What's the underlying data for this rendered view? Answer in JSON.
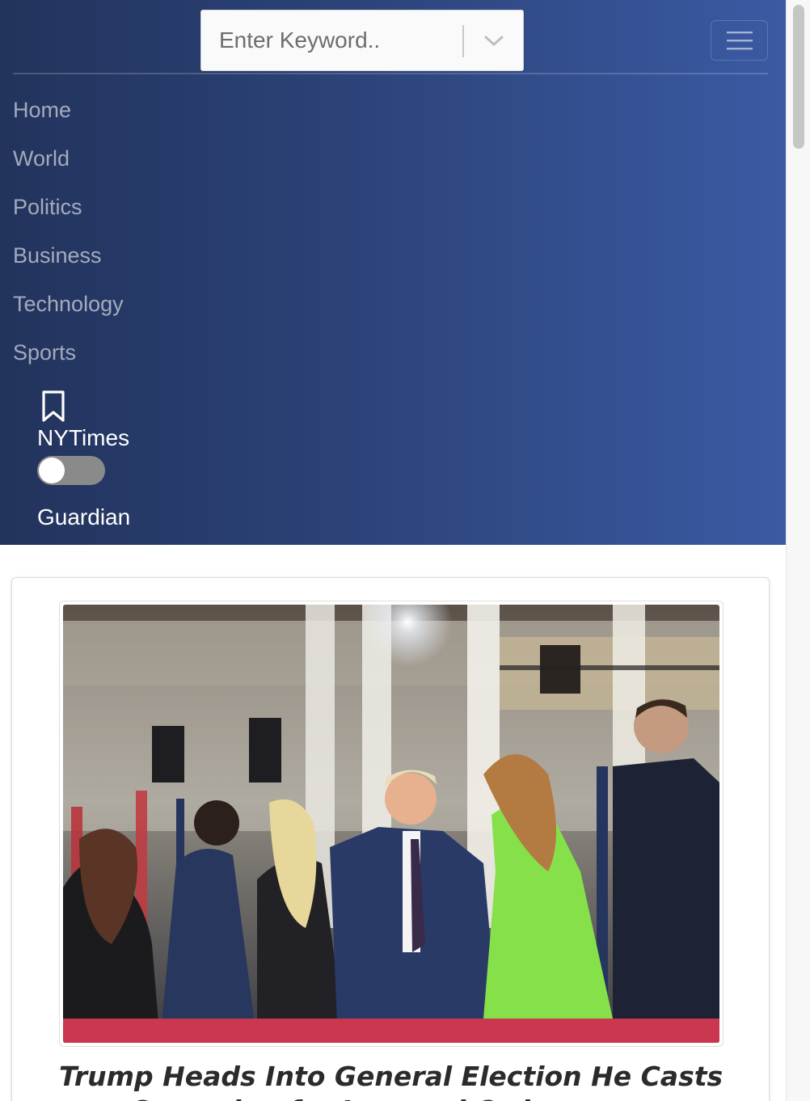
{
  "search": {
    "placeholder": "Enter Keyword.."
  },
  "nav": {
    "items": [
      {
        "label": "Home"
      },
      {
        "label": "World"
      },
      {
        "label": "Politics"
      },
      {
        "label": "Business"
      },
      {
        "label": "Technology"
      },
      {
        "label": "Sports"
      }
    ]
  },
  "sources": {
    "left_label": "NYTimes",
    "right_label": "Guardian",
    "toggle_on": false
  },
  "article": {
    "headline": "Trump Heads Into General Election He Casts as a Campaign for Law and Order"
  },
  "icons": {
    "search_dropdown": "chevron-down-icon",
    "menu": "hamburger-icon",
    "bookmark": "bookmark-icon"
  },
  "colors": {
    "nav_gradient_start": "#22335c",
    "nav_gradient_end": "#3b5aa3",
    "toggle_track": "#8a8a8a"
  }
}
